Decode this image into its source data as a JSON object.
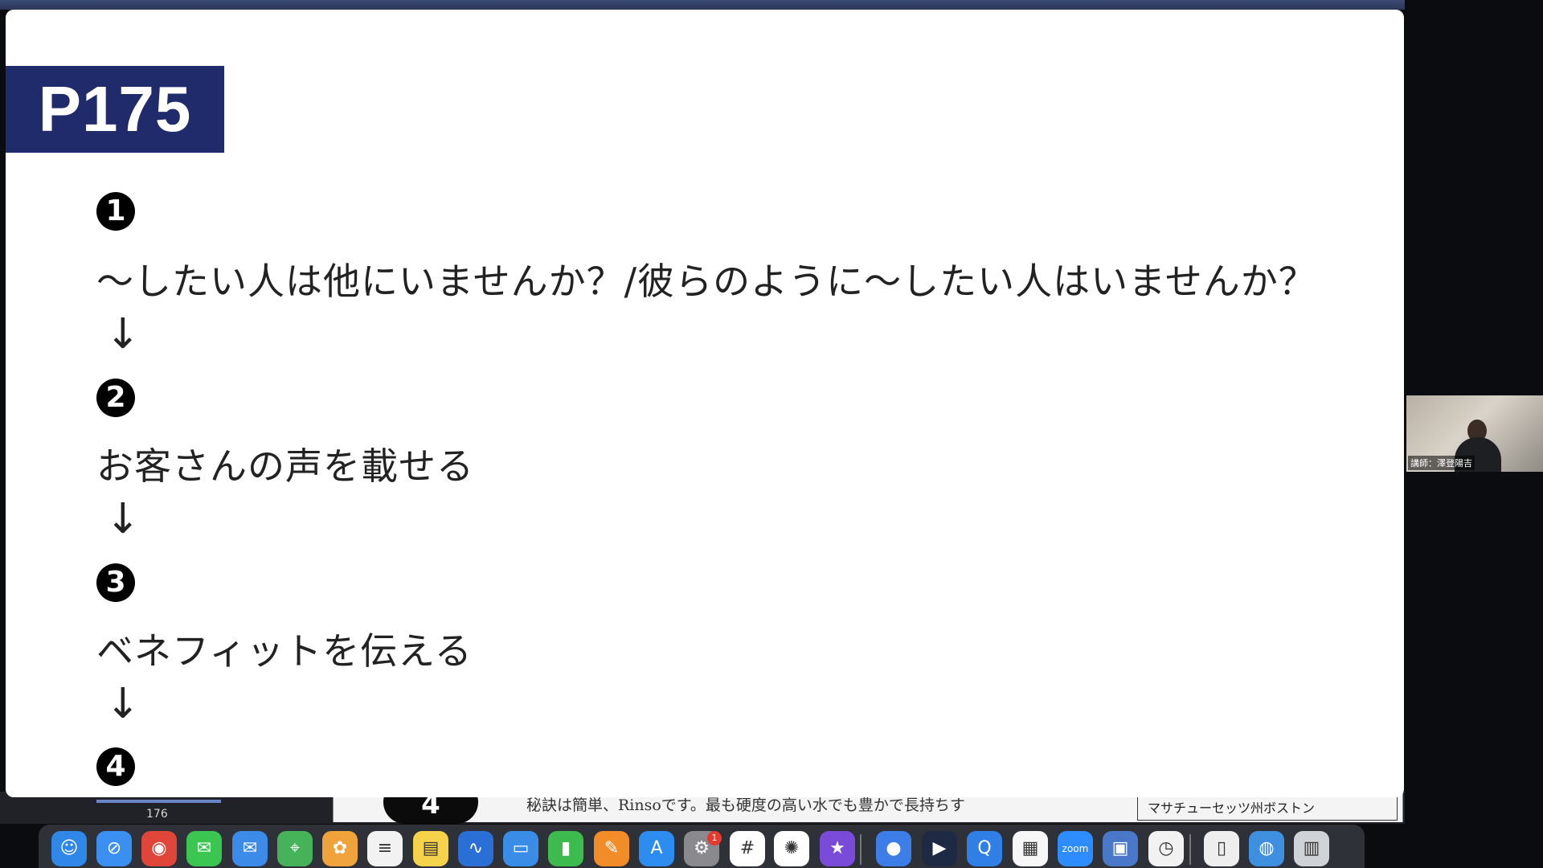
{
  "slide": {
    "page_label": "P175",
    "steps": [
      {
        "badge": "1",
        "text": "〜したい人は他にいませんか？/彼らのように〜したい人はいませんか？"
      },
      {
        "badge": "2",
        "text": "お客さんの声を載せる"
      },
      {
        "badge": "3",
        "text": "ベネフィットを伝える"
      },
      {
        "badge": "4",
        "text": ""
      }
    ],
    "arrow": "↓"
  },
  "background_document": {
    "page_number": "176",
    "step_number": "4",
    "partial_text": "秘訣は簡単、Rinsoです。最も硬度の高い水でも豊かで長持ちす",
    "boxed_text": "マサチューセッツ州ボストン"
  },
  "video": {
    "participant_name": "講師：澤登陽吉"
  },
  "dock": {
    "notification_count": "1",
    "apps": [
      {
        "name": "finder-icon",
        "glyph": "☺",
        "color": "#2f87e8"
      },
      {
        "name": "safari-icon",
        "glyph": "⊘",
        "color": "#3b8ff0"
      },
      {
        "name": "chrome-icon",
        "glyph": "◉",
        "color": "#e0453a"
      },
      {
        "name": "messages-icon",
        "glyph": "✉",
        "color": "#3ac651"
      },
      {
        "name": "mail-icon",
        "glyph": "✉",
        "color": "#3d8be8"
      },
      {
        "name": "maps-icon",
        "glyph": "⌖",
        "color": "#46b25a"
      },
      {
        "name": "photos-icon",
        "glyph": "✿",
        "color": "#f0a33a"
      },
      {
        "name": "reminders-icon",
        "glyph": "≡",
        "color": "#f2f2f2"
      },
      {
        "name": "notes-icon",
        "glyph": "▤",
        "color": "#f5d24a"
      },
      {
        "name": "freeform-icon",
        "glyph": "∿",
        "color": "#2a6fd6"
      },
      {
        "name": "keynote-icon",
        "glyph": "▭",
        "color": "#3a8de6"
      },
      {
        "name": "numbers-icon",
        "glyph": "▮",
        "color": "#3dbb4e"
      },
      {
        "name": "pages-icon",
        "glyph": "✎",
        "color": "#f28c28"
      },
      {
        "name": "app-store-icon",
        "glyph": "A",
        "color": "#2d8cf0"
      },
      {
        "name": "system-settings-icon",
        "glyph": "⚙",
        "color": "#8a8a8e"
      },
      {
        "name": "slack-icon",
        "glyph": "#",
        "color": "#ffffff"
      },
      {
        "name": "chatgpt-icon",
        "glyph": "✺",
        "color": "#ffffff"
      },
      {
        "name": "imovie-icon",
        "glyph": "★",
        "color": "#7a4ad8"
      },
      {
        "name": "app-circle-icon",
        "glyph": "●",
        "color": "#3d7de8"
      },
      {
        "name": "app-arrow-icon",
        "glyph": "▶",
        "color": "#1e2a44"
      },
      {
        "name": "quicktime-icon",
        "glyph": "Q",
        "color": "#2f7fe6"
      },
      {
        "name": "calendar-icon",
        "glyph": "▦",
        "color": "#f7f7f7"
      },
      {
        "name": "zoom-icon",
        "glyph": "zoom",
        "color": "#2d8cff"
      },
      {
        "name": "device-icon",
        "glyph": "▣",
        "color": "#4a78c8"
      },
      {
        "name": "clock-icon",
        "glyph": "◷",
        "color": "#f2f2f2"
      },
      {
        "name": "document-icon",
        "glyph": "▯",
        "color": "#eeeeee"
      },
      {
        "name": "globe-icon",
        "glyph": "◍",
        "color": "#3f8fe0"
      },
      {
        "name": "trash-icon",
        "glyph": "▥",
        "color": "#cfd2d6"
      }
    ]
  }
}
